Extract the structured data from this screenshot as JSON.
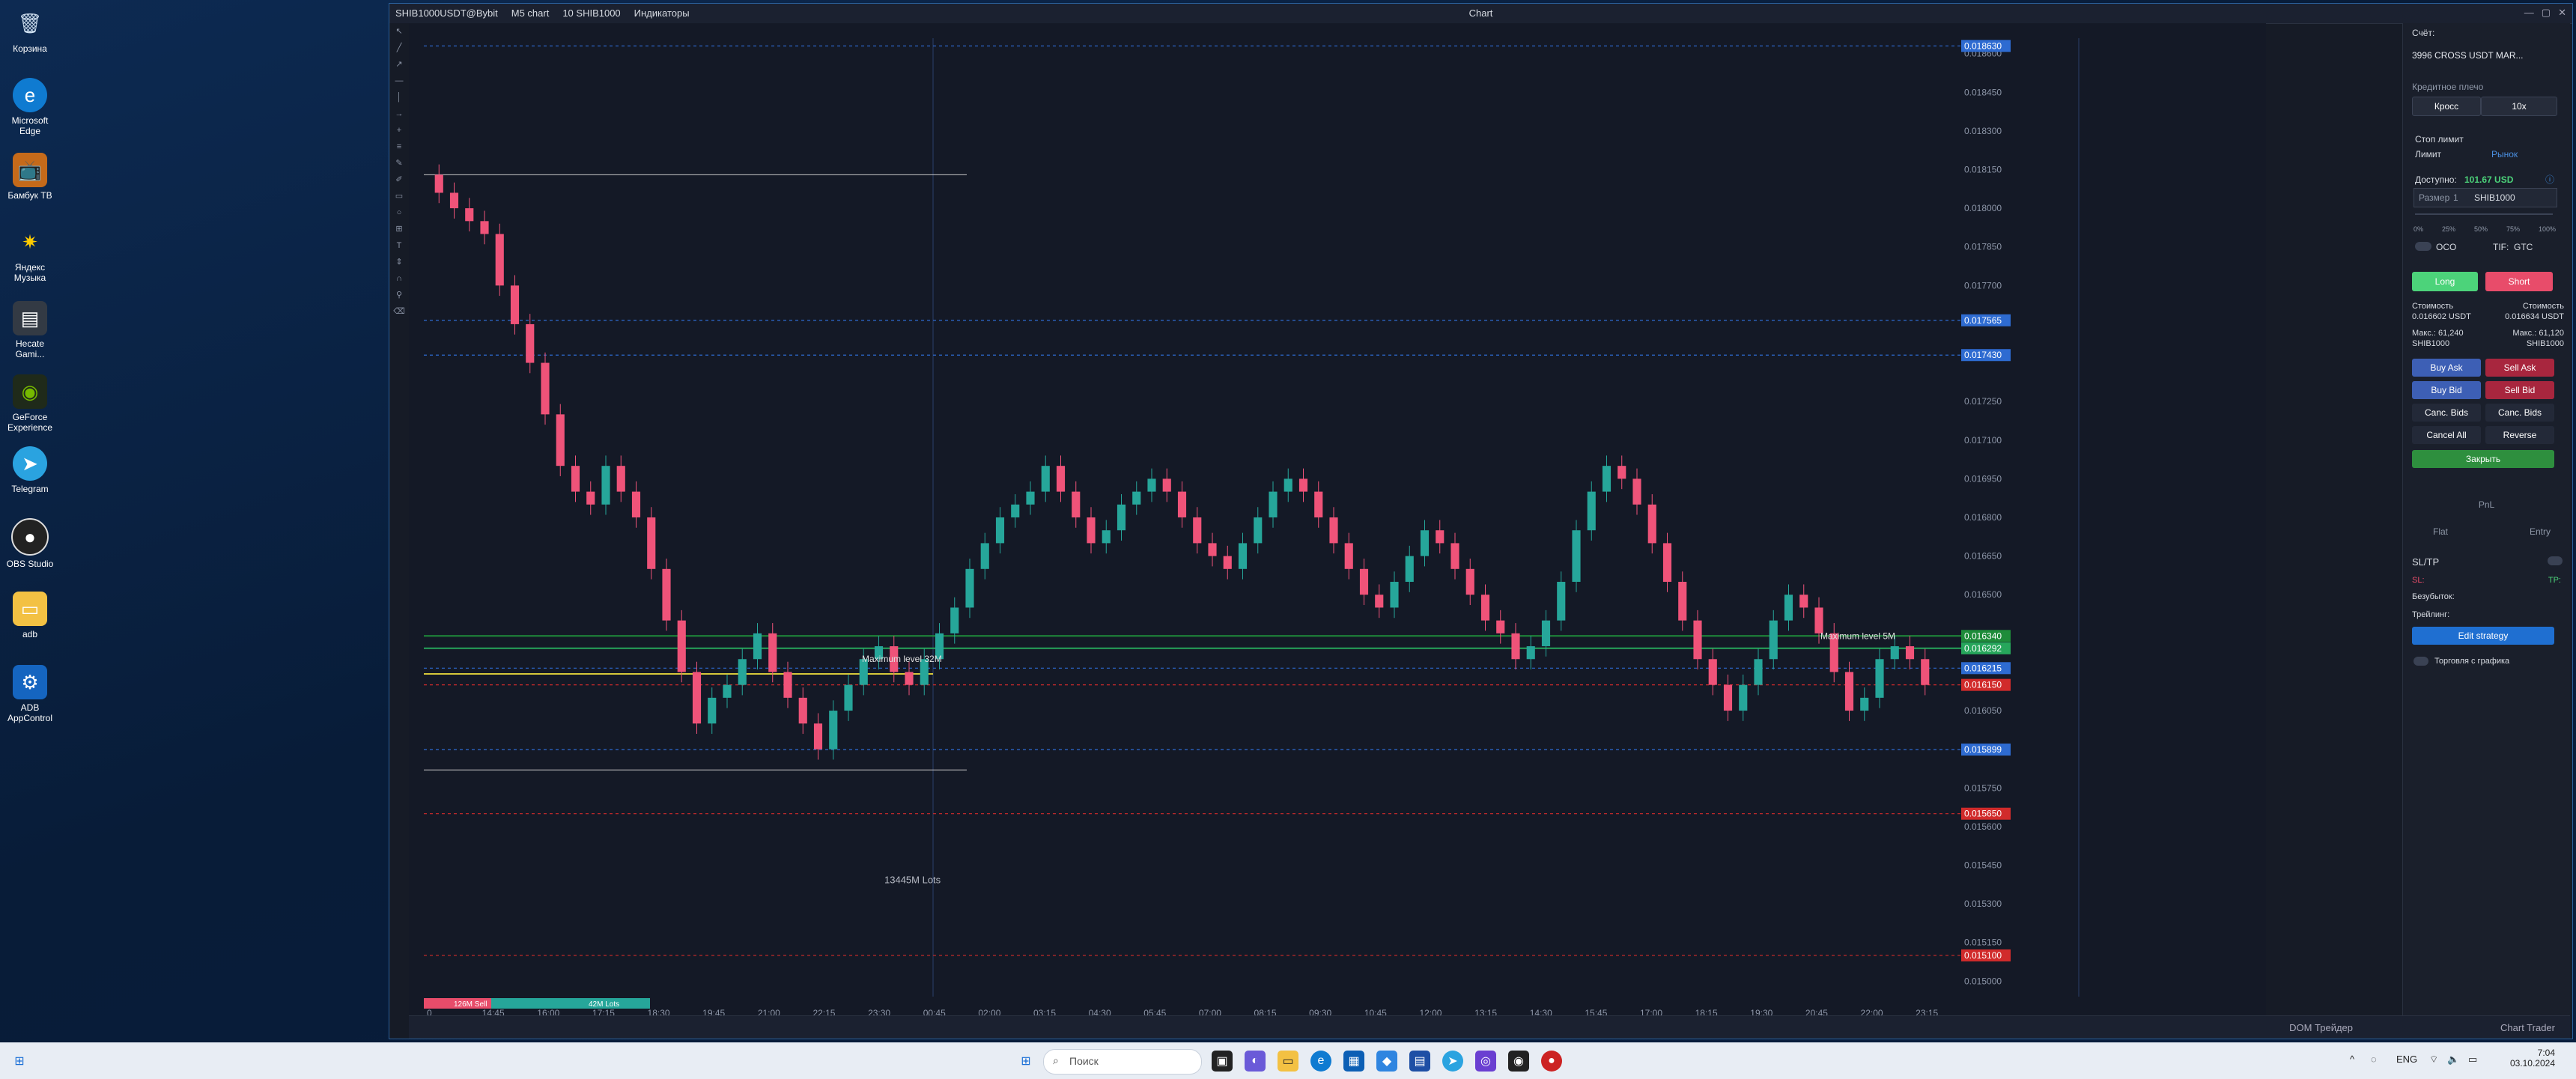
{
  "desktop": {
    "icons": [
      {
        "label": "Корзина",
        "icon": "recycle-bin-icon"
      },
      {
        "label": "Microsoft Edge",
        "icon": "edge-icon"
      },
      {
        "label": "Бамбук ТВ",
        "icon": "tv-icon"
      },
      {
        "label": "Яндекс Музыка",
        "icon": "music-icon"
      },
      {
        "label": "Hecate Gami...",
        "icon": "game-icon"
      },
      {
        "label": "GeForce Experience",
        "icon": "nvidia-icon"
      },
      {
        "label": "Telegram",
        "icon": "telegram-icon"
      },
      {
        "label": "OBS Studio",
        "icon": "obs-icon"
      },
      {
        "label": "adb",
        "icon": "folder-icon"
      },
      {
        "label": "ADB AppControl",
        "icon": "adb-icon"
      }
    ]
  },
  "app": {
    "window_title": "Chart",
    "toolbar": {
      "symbol": "SHIB1000USDT@Bybit",
      "timeframe": "M5 chart",
      "quantity": "10 SHIB1000",
      "indicators": "Индикаторы"
    },
    "chart_data": {
      "type": "candlestick",
      "x_ticks": [
        "0",
        "14:45",
        "16:00",
        "17:15",
        "18:30",
        "19:45",
        "21:00",
        "22:15",
        "23:30",
        "00:45",
        "02:00",
        "03:15",
        "04:30",
        "05:45",
        "07:00",
        "08:15",
        "09:30",
        "10:45",
        "12:00",
        "13:15",
        "14:30",
        "15:45",
        "17:00",
        "18:15",
        "19:30",
        "20:45",
        "22:00",
        "23:15"
      ],
      "y_ticks": [
        "0.018600",
        "0.018450",
        "0.018300",
        "0.018150",
        "0.018000",
        "0.017850",
        "0.017700",
        "0.017565",
        "0.017430",
        "0.017250",
        "0.017100",
        "0.016950",
        "0.016800",
        "0.016650",
        "0.016500",
        "0.016350",
        "0.016215",
        "0.016050",
        "0.015899",
        "0.015900",
        "0.015750",
        "0.015600",
        "0.015450",
        "0.015300",
        "0.015150",
        "0.015000"
      ],
      "ylim": [
        0.01494,
        0.01866
      ],
      "price_labels": [
        {
          "value": "0.018630",
          "color": "#2e6bd1"
        },
        {
          "value": "0.017565",
          "color": "#2e6bd1"
        },
        {
          "value": "0.017430",
          "color": "#2e6bd1"
        },
        {
          "value": "0.016340",
          "color": "#1e8c3a"
        },
        {
          "value": "0.016292",
          "color": "#26a65b"
        },
        {
          "value": "0.016215",
          "color": "#2e6bd1"
        },
        {
          "value": "0.016150",
          "color": "#d12b2b"
        },
        {
          "value": "0.015899",
          "color": "#2e6bd1"
        },
        {
          "value": "0.015650",
          "color": "#d12b2b"
        },
        {
          "value": "0.015100",
          "color": "#d12b2b"
        }
      ],
      "annotations": {
        "max_level_5m": "Maximum level 5M",
        "max_level_label": "Maximum level 32M",
        "lots": "13445M Lots",
        "volume_left": "126M Sell",
        "volume_right": "42M Lots"
      },
      "price_path": [
        0.01813,
        0.01806,
        0.018,
        0.01795,
        0.0179,
        0.0177,
        0.01755,
        0.0174,
        0.0172,
        0.017,
        0.0169,
        0.01685,
        0.017,
        0.0169,
        0.0168,
        0.0166,
        0.0164,
        0.0162,
        0.016,
        0.0161,
        0.01615,
        0.01625,
        0.01635,
        0.0162,
        0.0161,
        0.016,
        0.0159,
        0.01605,
        0.01615,
        0.01625,
        0.0163,
        0.0162,
        0.01615,
        0.01625,
        0.01635,
        0.01645,
        0.0166,
        0.0167,
        0.0168,
        0.01685,
        0.0169,
        0.017,
        0.0169,
        0.0168,
        0.0167,
        0.01675,
        0.01685,
        0.0169,
        0.01695,
        0.0169,
        0.0168,
        0.0167,
        0.01665,
        0.0166,
        0.0167,
        0.0168,
        0.0169,
        0.01695,
        0.0169,
        0.0168,
        0.0167,
        0.0166,
        0.0165,
        0.01645,
        0.01655,
        0.01665,
        0.01675,
        0.0167,
        0.0166,
        0.0165,
        0.0164,
        0.01635,
        0.01625,
        0.0163,
        0.0164,
        0.01655,
        0.01675,
        0.0169,
        0.017,
        0.01695,
        0.01685,
        0.0167,
        0.01655,
        0.0164,
        0.01625,
        0.01615,
        0.01605,
        0.01615,
        0.01625,
        0.0164,
        0.0165,
        0.01645,
        0.01635,
        0.0162,
        0.01605,
        0.0161,
        0.01625,
        0.0163,
        0.01625,
        0.01615
      ]
    },
    "panel": {
      "account_label": "Счёт:",
      "account_value": "3996 CROSS USDT MAR...",
      "leverage_label": "Кредитное плечо",
      "cross": "Кросс",
      "leverage": "10x",
      "stop_limit": "Стоп лимит",
      "limit": "Лимит",
      "market": "Рынок",
      "available_label": "Доступно:",
      "available_value": "101.67 USD",
      "size_label": "Размер",
      "size_value": "1",
      "size_unit": "SHIB1000",
      "slider_ticks": [
        "0%",
        "25%",
        "50%",
        "75%",
        "100%"
      ],
      "oco": "OCO",
      "tif": "TIF:",
      "tif_value": "GTC",
      "long": "Long",
      "short": "Short",
      "cost_left_label": "Стоимость",
      "cost_left": "0.016602 USDT",
      "cost_right_label": "Стоимость",
      "cost_right": "0.016634 USDT",
      "max_left": "Макс.: 61,240",
      "max_left_unit": "SHIB1000",
      "max_right": "Макс.: 61,120",
      "max_right_unit": "SHIB1000",
      "buy_ask": "Buy Ask",
      "sell_ask": "Sell Ask",
      "buy_bid": "Buy Bid",
      "sell_bid": "Sell Bid",
      "canc_bids_l": "Canc. Bids",
      "canc_bids_r": "Canc. Bids",
      "cancel_all": "Cancel All",
      "reverse": "Reverse",
      "close": "Закрыть",
      "pnl": "PnL",
      "flat": "Flat",
      "entry": "Entry",
      "sltp": "SL/TP",
      "sl": "SL:",
      "tp": "TP:",
      "breakeven": "Безубыток:",
      "trailing": "Трейлинг:",
      "edit_strategy": "Edit strategy",
      "trade_from_chart": "Торговля с графика"
    },
    "bottom": {
      "dom": "DOM Трейдер",
      "chart_trader": "Chart Trader"
    }
  },
  "taskbar": {
    "search": "Поиск",
    "lang": "ENG",
    "time": "7:04",
    "date": "03.10.2024"
  },
  "colors": {
    "up": "#26a69a",
    "down": "#ef5379",
    "long": "#4cd37a",
    "short": "#e84c6a"
  }
}
